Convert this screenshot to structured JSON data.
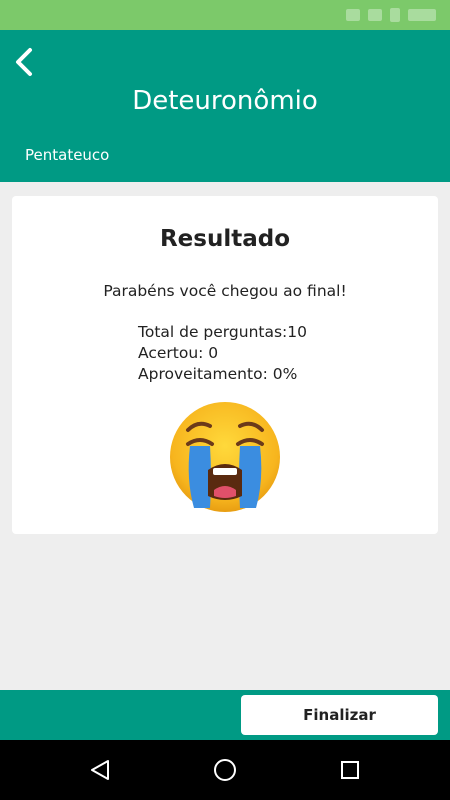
{
  "header": {
    "title": "Deteuronômio",
    "subtitle": "Pentateuco",
    "back_icon": "back-arrow-icon"
  },
  "result": {
    "title": "Resultado",
    "message": "Parabéns você chegou ao final!",
    "total_questions": "Total de perguntas:10",
    "correct": "Acertou: 0",
    "performance": "Aproveitamento: 0%",
    "emoji_icon": "loudly-crying-face-icon"
  },
  "footer": {
    "finish_label": "Finalizar"
  },
  "navigation": {
    "back_icon": "nav-back-icon",
    "home_icon": "nav-home-icon",
    "recents_icon": "nav-recents-icon"
  },
  "colors": {
    "primary": "#009a84",
    "status_bar": "#7cc96a",
    "background": "#eeeeee",
    "card": "#ffffff"
  }
}
